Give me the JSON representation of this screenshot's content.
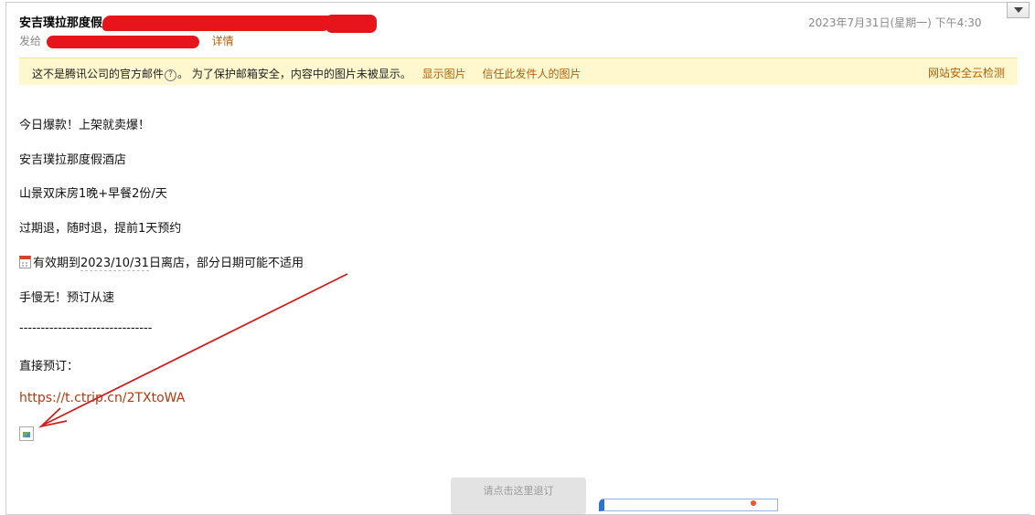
{
  "header": {
    "subject_prefix": "安吉璞拉那度假",
    "date": "2023年7月31日(星期一) 下午4:30",
    "to_label": "发给",
    "detail_link": "详情"
  },
  "warning": {
    "text_before_icon": "这不是腾讯公司的官方邮件",
    "help_icon": "?",
    "text_after_icon": "。 为了保护邮箱安全，内容中的图片未被显示。",
    "show_images": "显示图片",
    "trust_sender": "信任此发件人的图片",
    "security_check": "网站安全云检测"
  },
  "body": {
    "line1": "今日爆款！上架就卖爆！",
    "line2": "安吉璞拉那度假酒店",
    "line3": "山景双床房1晚+早餐2份/天",
    "line4": "过期退，随时退，提前1天预约",
    "line5_prefix": "有效期到",
    "line5_date": "2023/10/31",
    "line5_suffix": "日离店，部分日期可能不适用",
    "line6": "手慢无！预订从速",
    "divider": "-------------------------------",
    "book_label": "直接预订：",
    "book_url": "https://t.ctrip.cn/2TXtoWA"
  },
  "footer": {
    "unsubscribe": "请点击这里退订"
  },
  "colors": {
    "link": "#b0600c",
    "url": "#b13a0e",
    "warning_bg": "#fff7ce",
    "redaction": "#e8141b",
    "annotation_arrow": "#d11f1f"
  },
  "icons": {
    "scroll": "chevron-down-icon",
    "help": "question-circle-icon",
    "calendar": "calendar-icon",
    "broken_image": "broken-image-icon"
  }
}
